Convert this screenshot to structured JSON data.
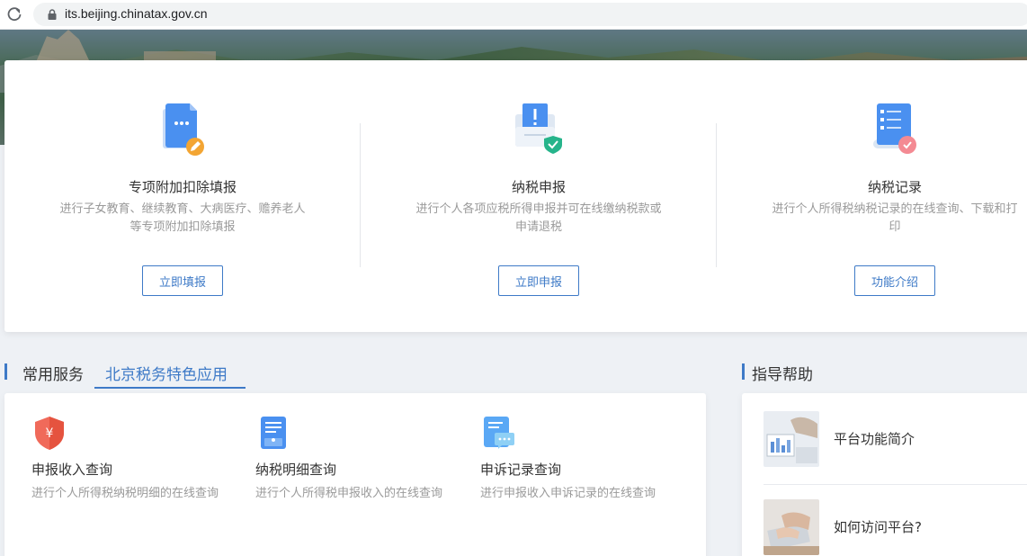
{
  "browser": {
    "url": "its.beijing.chinatax.gov.cn"
  },
  "top_services": [
    {
      "title": "专项附加扣除填报",
      "desc": "进行子女教育、继续教育、大病医疗、赡养老人等专项附加扣除填报",
      "button": "立即填报",
      "icon": "document-edit-icon"
    },
    {
      "title": "纳税申报",
      "desc": "进行个人各项应税所得申报并可在线缴纳税款或申请退税",
      "button": "立即申报",
      "icon": "tax-declare-icon"
    },
    {
      "title": "纳税记录",
      "desc": "进行个人所得税纳税记录的在线查询、下载和打印",
      "button": "功能介绍",
      "icon": "tax-record-icon"
    }
  ],
  "common_section": {
    "title": "常用服务",
    "active_tab": "北京税务特色应用",
    "accent_color": "#3e7ac7",
    "items": [
      {
        "title": "申报收入查询",
        "desc": "进行个人所得税纳税明细的在线查询",
        "icon": "yen-shield-icon"
      },
      {
        "title": "纳税明细查询",
        "desc": "进行个人所得税申报收入的在线查询",
        "icon": "detail-doc-icon"
      },
      {
        "title": "申诉记录查询",
        "desc": "进行申报收入申诉记录的在线查询",
        "icon": "appeal-chat-icon"
      }
    ]
  },
  "help_section": {
    "title": "指导帮助",
    "items": [
      {
        "label": "平台功能简介",
        "icon": "platform-intro-thumbnail"
      },
      {
        "label": "如何访问平台?",
        "icon": "access-guide-thumbnail"
      }
    ]
  }
}
